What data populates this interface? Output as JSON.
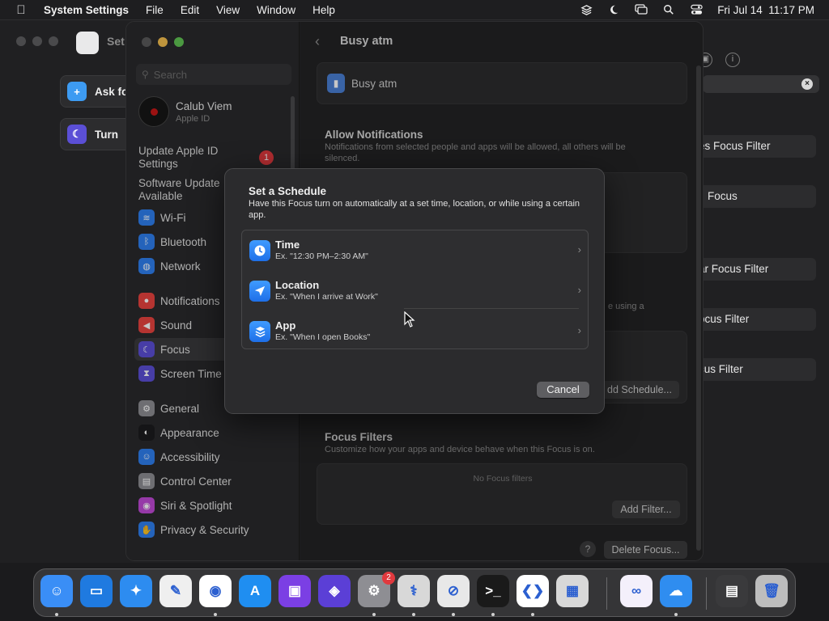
{
  "menubar": {
    "app_name": "System Settings",
    "menus": [
      "File",
      "Edit",
      "View",
      "Window",
      "Help"
    ],
    "datetime": "Fri Jul 14  11:17 PM",
    "status_icons": [
      "layers-icon",
      "moon-icon",
      "screen-mirroring-icon",
      "search-icon",
      "control-center-icon"
    ]
  },
  "background_window": {
    "title": "Set",
    "shortcuts": [
      {
        "label": "Ask fo",
        "icon": "chat-plus-icon",
        "color": "#3d9bf2"
      },
      {
        "label": "Turn",
        "icon": "moon-icon",
        "color": "#5b4fd6"
      }
    ],
    "filters": [
      "es Focus Filter",
      "Focus",
      "ar Focus Filter",
      "ocus Filter",
      "cus Filter"
    ]
  },
  "sidebar": {
    "search_placeholder": "Search",
    "account": {
      "name": "Calub Viem",
      "subtitle": "Apple ID"
    },
    "update_apple_id": "Update Apple ID Settings",
    "update_badge": "1",
    "software_update": "Software Update Available",
    "items": [
      {
        "label": "Wi-Fi",
        "icon": "wifi-icon",
        "color": "#2f7ff0"
      },
      {
        "label": "Bluetooth",
        "icon": "bluetooth-icon",
        "color": "#2f7ff0"
      },
      {
        "label": "Network",
        "icon": "globe-icon",
        "color": "#2f7ff0"
      },
      {
        "label": "Notifications",
        "icon": "bell-icon",
        "color": "#e8433f"
      },
      {
        "label": "Sound",
        "icon": "speaker-icon",
        "color": "#e8433f"
      },
      {
        "label": "Focus",
        "icon": "moon-icon",
        "color": "#5b4fd6"
      },
      {
        "label": "Screen Time",
        "icon": "hourglass-icon",
        "color": "#5b4fd6"
      },
      {
        "label": "General",
        "icon": "gear-icon",
        "color": "#8e8e93"
      },
      {
        "label": "Appearance",
        "icon": "appearance-icon",
        "color": "#1c1c1e"
      },
      {
        "label": "Accessibility",
        "icon": "accessibility-icon",
        "color": "#2f7ff0"
      },
      {
        "label": "Control Center",
        "icon": "control-center-icon",
        "color": "#8e8e93"
      },
      {
        "label": "Siri & Spotlight",
        "icon": "siri-icon",
        "color": "#c04ad8"
      },
      {
        "label": "Privacy & Security",
        "icon": "hand-icon",
        "color": "#2f7ff0"
      }
    ]
  },
  "main": {
    "title": "Busy atm",
    "focus_name": "Busy atm",
    "allow_notifications": {
      "heading": "Allow Notifications",
      "description": "Notifications from selected people and apps will be allowed, all others will be silenced."
    },
    "partial_text": "e using a",
    "add_schedule": "dd Schedule...",
    "focus_filters": {
      "heading": "Focus Filters",
      "description": "Customize how your apps and device behave when this Focus is on.",
      "empty": "No Focus filters",
      "add_button": "Add Filter..."
    },
    "delete_button": "Delete Focus...",
    "help": "?"
  },
  "sheet": {
    "title": "Set a Schedule",
    "description": "Have this Focus turn on automatically at a set time, location, or while using a certain app.",
    "options": [
      {
        "title": "Time",
        "subtitle": "Ex. \"12:30 PM–2:30 AM\"",
        "icon": "clock-icon"
      },
      {
        "title": "Location",
        "subtitle": "Ex. \"When I arrive at Work\"",
        "icon": "location-arrow-icon"
      },
      {
        "title": "App",
        "subtitle": "Ex. \"When I open Books\"",
        "icon": "app-stack-icon"
      }
    ],
    "cancel": "Cancel"
  },
  "dock": {
    "apps": [
      {
        "name": "Finder",
        "icon": "finder-icon",
        "color": "#3a8ef6"
      },
      {
        "name": "Keynote",
        "icon": "keynote-icon",
        "color": "#1f7ae0"
      },
      {
        "name": "Safari",
        "icon": "compass-icon",
        "color": "#2d8cf0"
      },
      {
        "name": "TextEdit",
        "icon": "textedit-icon",
        "color": "#efefef"
      },
      {
        "name": "Chrome",
        "icon": "chrome-icon",
        "color": "#ffffff"
      },
      {
        "name": "App Store",
        "icon": "app-store-icon",
        "color": "#1f8ef1"
      },
      {
        "name": "Podcasts Utility",
        "icon": "purple-app-icon",
        "color": "#7b3fe4"
      },
      {
        "name": "Shortcuts",
        "icon": "shortcuts-icon",
        "color": "#5b3fd6"
      },
      {
        "name": "System Settings",
        "icon": "gear-icon",
        "color": "#8e8e93"
      },
      {
        "name": "Disk Utility",
        "icon": "stethoscope-icon",
        "color": "#d8d8d8"
      },
      {
        "name": "Instruments",
        "icon": "instruments-icon",
        "color": "#e8e8e8"
      },
      {
        "name": "Terminal",
        "icon": "terminal-icon",
        "color": "#1a1a1a"
      },
      {
        "name": "VS Code",
        "icon": "vscode-icon",
        "color": "#ffffff"
      },
      {
        "name": "Launchpad",
        "icon": "launchpad-icon",
        "color": "#d8d8d8"
      },
      {
        "name": "Visual Studio",
        "icon": "visual-studio-icon",
        "color": "#f4f0fb"
      },
      {
        "name": "Weather",
        "icon": "weather-icon",
        "color": "#2f8df0"
      },
      {
        "name": "Screen Window",
        "icon": "window-icon",
        "color": "#3a3a3c"
      },
      {
        "name": "Trash",
        "icon": "trash-icon",
        "color": "#bdbdbd"
      }
    ],
    "settings_badge": "2"
  }
}
